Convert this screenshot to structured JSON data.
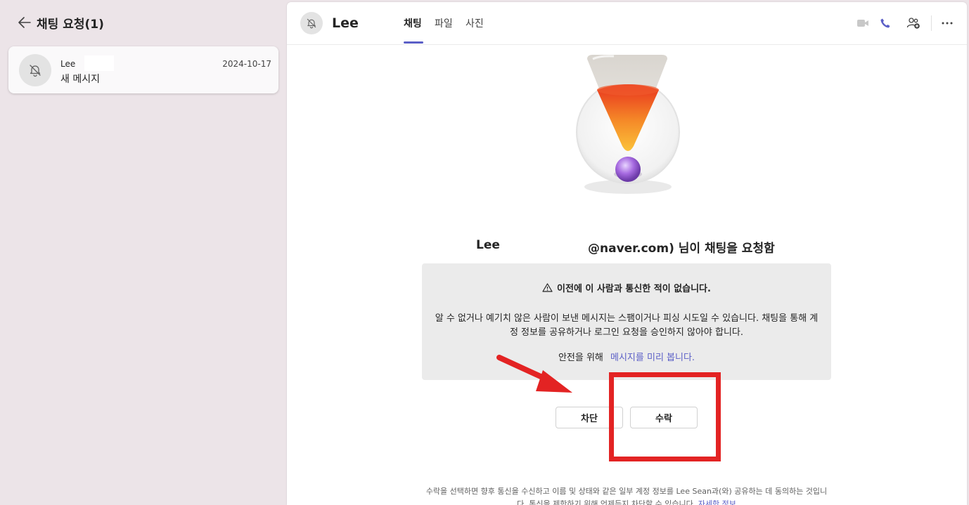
{
  "left": {
    "title": "채팅 요청(1)",
    "request": {
      "name": "Lee",
      "date": "2024-10-17",
      "message": "새 메시지"
    }
  },
  "header": {
    "name": "Lee",
    "tabs": [
      {
        "label": "채팅",
        "active": true
      },
      {
        "label": "파일",
        "active": false
      },
      {
        "label": "사진",
        "active": false
      }
    ],
    "icons": [
      "video-icon",
      "phone-icon",
      "people-add-icon",
      "more-icon"
    ]
  },
  "main": {
    "request_name": "Lee",
    "request_text": "@naver.com) 님이 채팅을 요청함",
    "warning": {
      "title": "이전에 이 사람과 통신한 적이 없습니다.",
      "body": "알 수 없거나 예기치 않은 사람이 보낸 메시지는 스팸이거나 피싱 시도일 수 있습니다. 채팅을 통해 계정 정보를 공유하거나 로그인 요청을 승인하지 않아야 합니다.",
      "preview_prefix": "안전을 위해",
      "preview_link": "메시지를 미리 봅니다."
    },
    "block_label": "차단",
    "accept_label": "수락",
    "footer_text": "수락을 선택하면 향후 통신을 수신하고 이름 및 상태와 같은 일부 계정 정보를 Lee Sean과(와) 공유하는 데 동의하는 것입니다. 통신을 제한하기 위해 언제든지 차단할 수 있습니다.",
    "footer_link": "자세한 정보"
  },
  "colors": {
    "accent": "#5b5fc7",
    "annotation": "#e32323"
  }
}
